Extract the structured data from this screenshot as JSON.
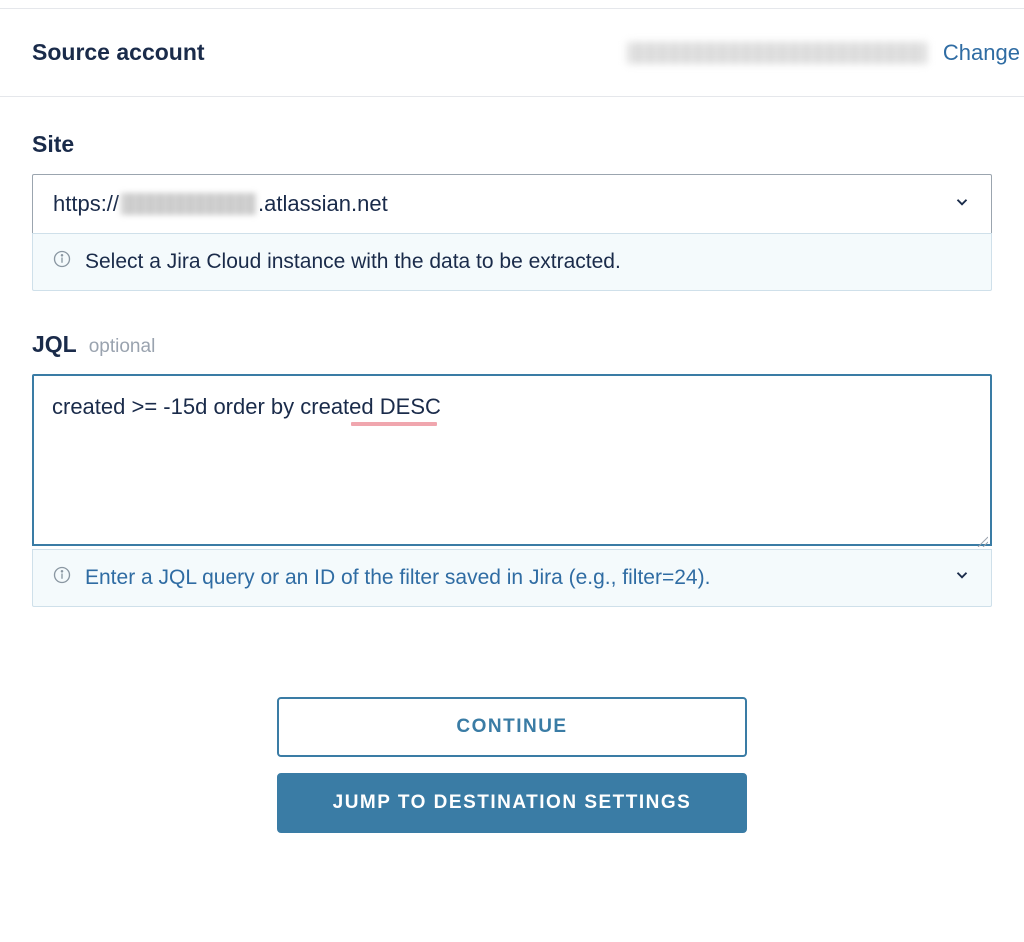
{
  "header": {
    "title": "Source account",
    "change_label": "Change"
  },
  "site": {
    "label": "Site",
    "value_prefix": "https://",
    "value_suffix": ".atlassian.net",
    "info_text": "Select a Jira Cloud instance with the data to be extracted."
  },
  "jql": {
    "label": "JQL",
    "optional_label": "optional",
    "value": "created >= -15d order by created DESC",
    "info_text": "Enter a JQL query or an ID of the filter saved in Jira (e.g., filter=24)."
  },
  "buttons": {
    "continue": "Continue",
    "jump": "Jump to Destination Settings"
  }
}
